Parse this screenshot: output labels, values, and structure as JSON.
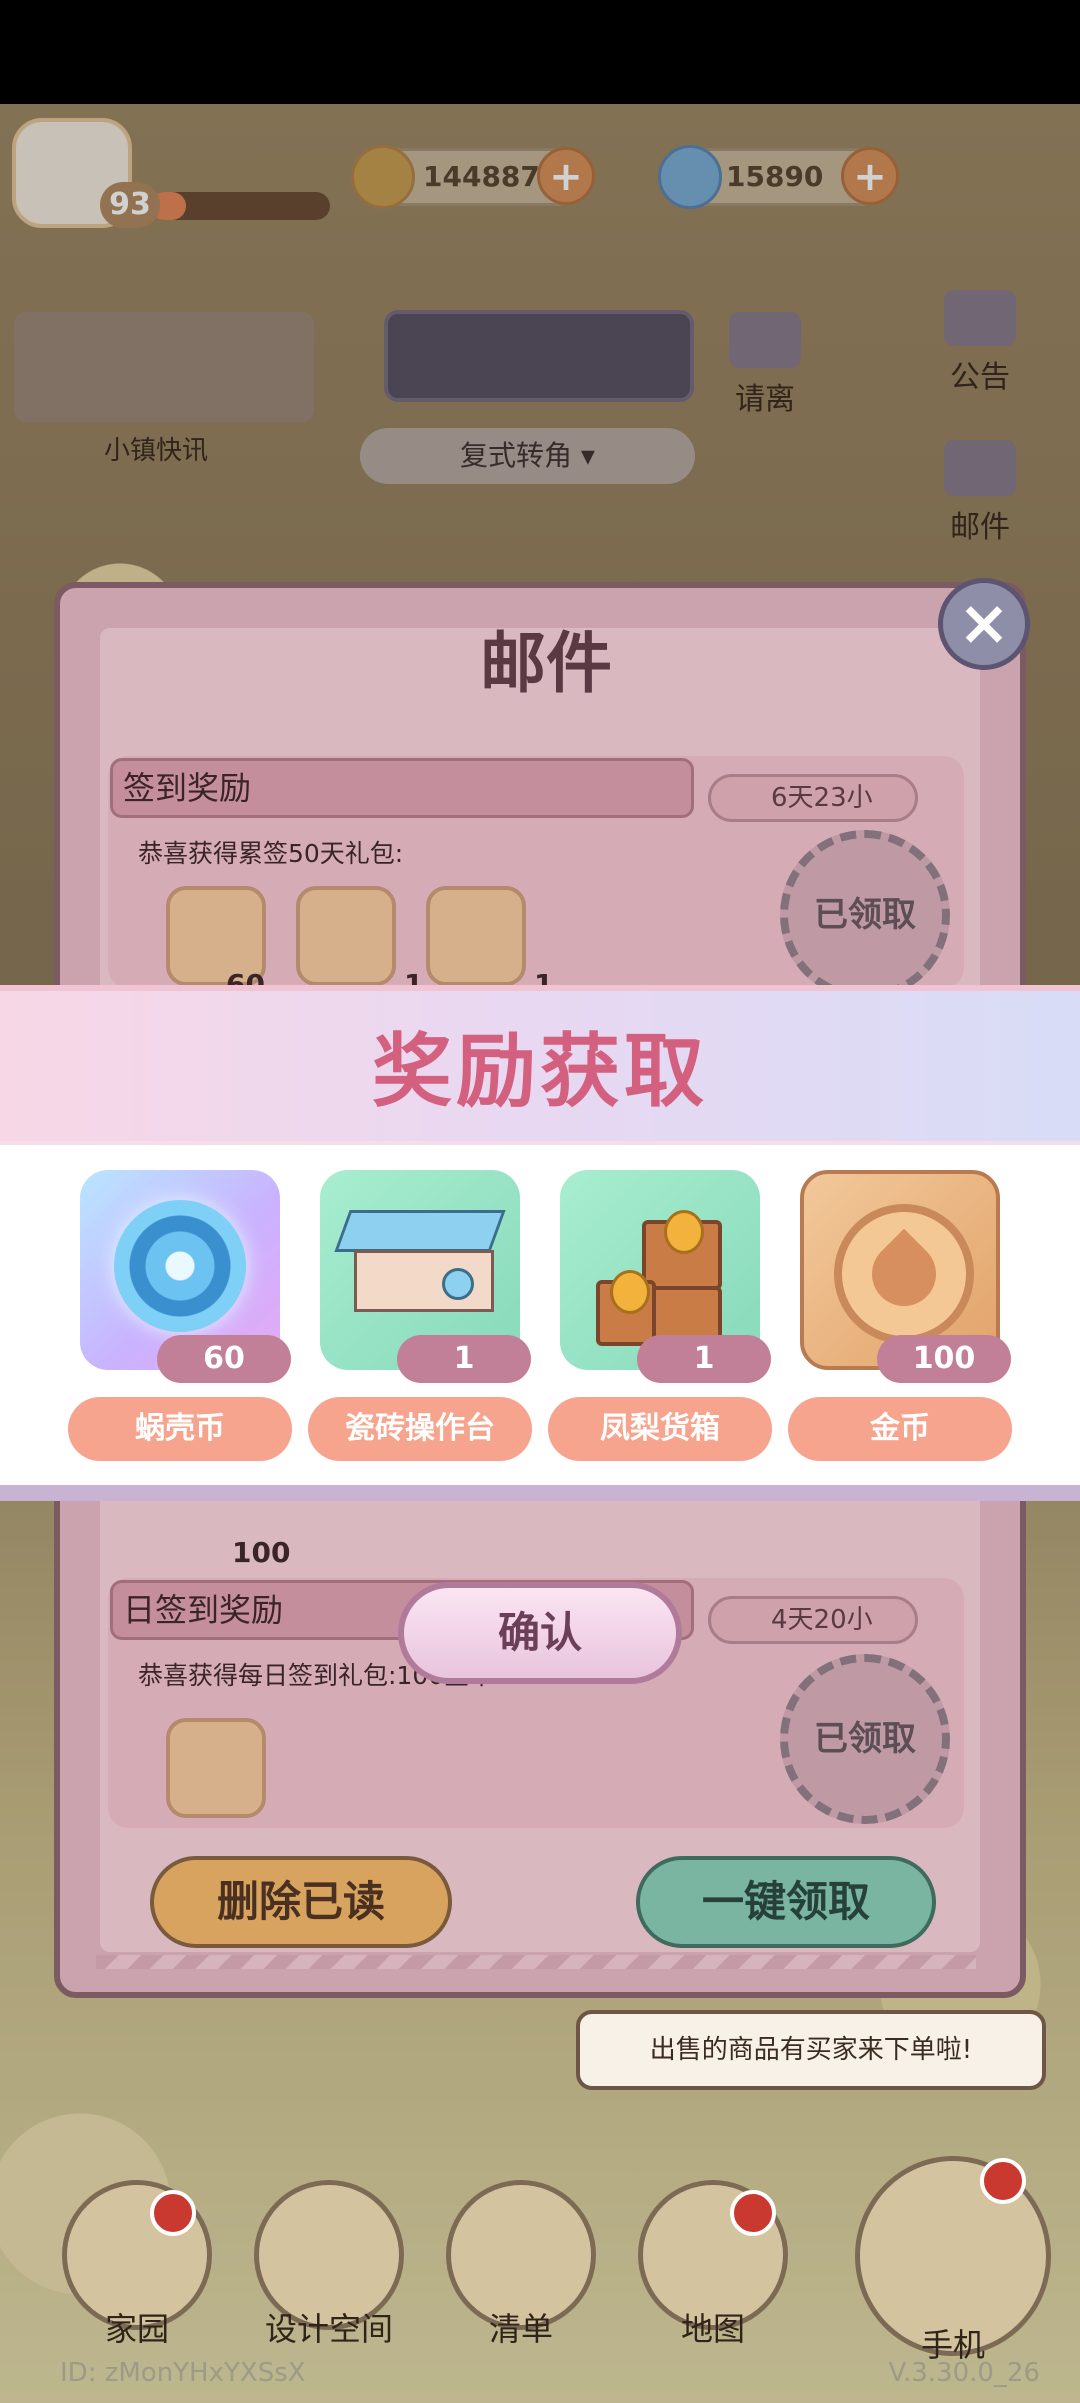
{
  "hud": {
    "level": "93",
    "coins": "1448879",
    "snail_coins": "15890",
    "xp_progress": 0.2,
    "town_news_label": "小镇快讯",
    "leave_label": "请离",
    "notice_label": "公告",
    "mail_label": "邮件",
    "location": "复式转角"
  },
  "mail": {
    "title": "邮件",
    "items": [
      {
        "title": "签到奖励",
        "timer": "6天23小",
        "desc": "恭喜获得累签50天礼包:",
        "status": "已领取",
        "thumb_counts": [
          "60",
          "1",
          "1"
        ]
      },
      {
        "title": "日签到奖励",
        "timer": "4天20小",
        "desc": "恭喜获得每日签到礼包:100金币",
        "status": "已领取"
      }
    ],
    "hidden_count": "100",
    "delete_read": "删除已读",
    "claim_all": "一键领取"
  },
  "reward": {
    "title": "奖励获取",
    "items": [
      {
        "name": "蜗壳币",
        "count": "60",
        "icon": "snail-coin-icon"
      },
      {
        "name": "瓷砖操作台",
        "count": "1",
        "icon": "tile-workbench-icon"
      },
      {
        "name": "凤梨货箱",
        "count": "1",
        "icon": "pineapple-crate-icon"
      },
      {
        "name": "金币",
        "count": "100",
        "icon": "gold-coin-icon"
      }
    ],
    "confirm": "确认"
  },
  "bottom": {
    "chat": "出售的商品有买家来下单啦!",
    "nav": [
      "家园",
      "设计空间",
      "清单",
      "地图"
    ],
    "phone": "手机",
    "id": "ID: zMonYHxYXSsX",
    "version": "V.3.30.0_26"
  },
  "colors": {
    "reward_title": "#d4607f",
    "count_badge": "#c27f98",
    "name_pill": "#f6a48d"
  }
}
